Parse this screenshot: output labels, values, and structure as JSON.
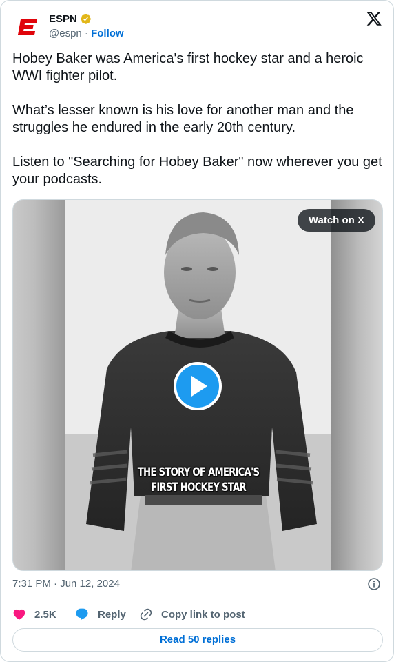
{
  "author": {
    "name": "ESPN",
    "handle": "@espn",
    "separator": " · ",
    "follow_label": "Follow",
    "brand_color": "#e0040b",
    "verified_color": "#e2b719"
  },
  "tweet": {
    "paragraphs": [
      "Hobey Baker was America's first hockey star and a heroic WWI fighter pilot.",
      "What’s lesser known is his love for another man and the struggles he endured in the early 20th century.",
      "Listen to \"Searching for Hobey Baker\" now wherever you get your podcasts."
    ]
  },
  "media": {
    "watch_label": "Watch on X",
    "overlay_line1": "THE STORY OF AMERICA'S",
    "overlay_line2": "FIRST HOCKEY STAR",
    "play_color": "#1d9bf0"
  },
  "meta": {
    "timestamp": "7:31 PM · Jun 12, 2024"
  },
  "actions": {
    "likes": "2.5K",
    "reply_label": "Reply",
    "copy_label": "Copy link to post",
    "like_color": "#f91880",
    "reply_color": "#1d9bf0"
  },
  "read_replies_label": "Read 50 replies",
  "icons": [
    "espn-logo-icon",
    "verified-badge-icon",
    "x-logo-icon",
    "play-icon",
    "info-icon",
    "heart-icon",
    "reply-bubble-icon",
    "link-icon"
  ]
}
